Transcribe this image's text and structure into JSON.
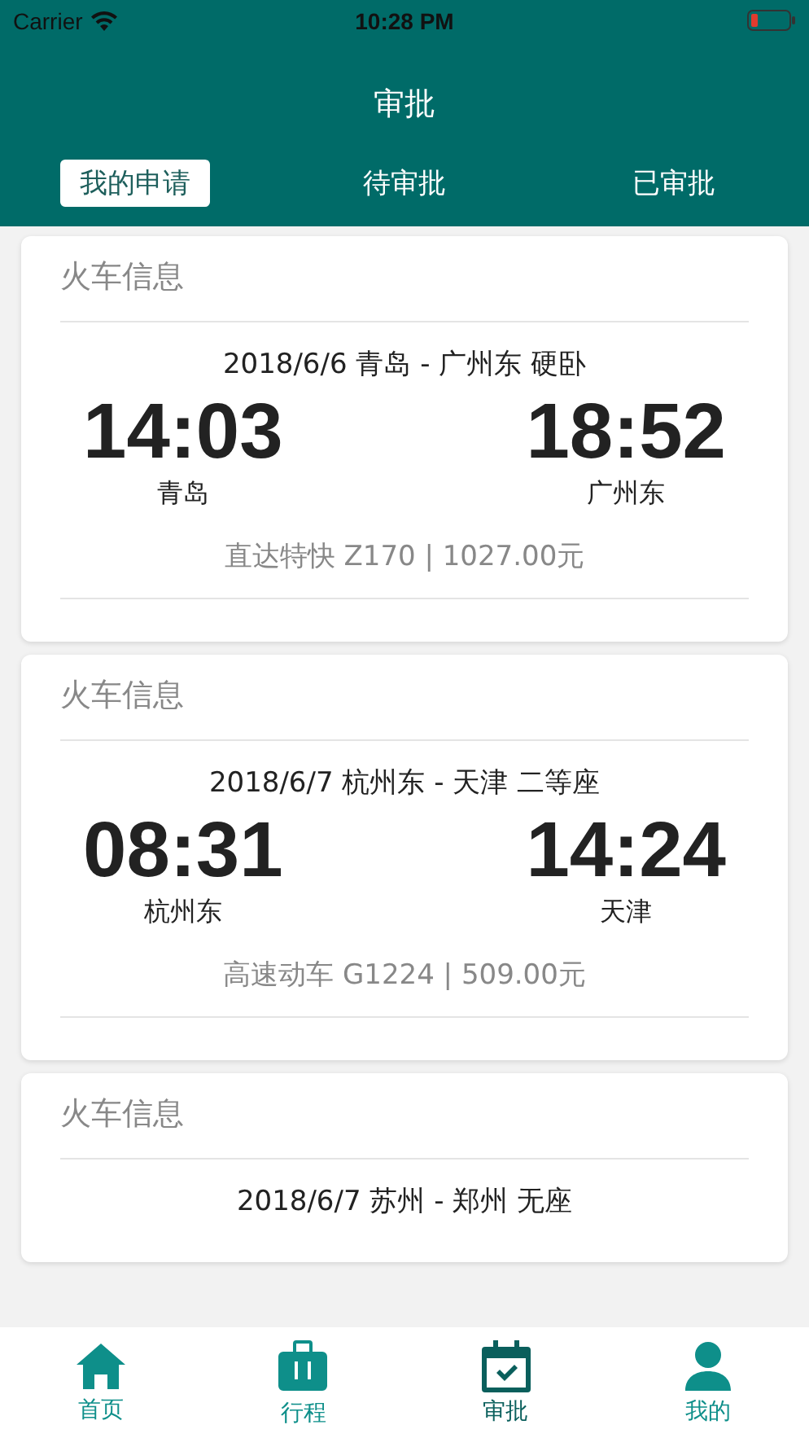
{
  "status_bar": {
    "carrier": "Carrier",
    "time": "10:28 PM"
  },
  "title": "审批",
  "tabs": [
    {
      "label": "我的申请",
      "selected": true
    },
    {
      "label": "待审批",
      "selected": false
    },
    {
      "label": "已审批",
      "selected": false
    }
  ],
  "cards": [
    {
      "heading": "火车信息",
      "route": "2018/6/6  青岛 - 广州东  硬卧",
      "depart_time": "14:03",
      "arrive_time": "18:52",
      "depart_station": "青岛",
      "arrive_station": "广州东",
      "train": "直达特快 Z170 | 1027.00元"
    },
    {
      "heading": "火车信息",
      "route": "2018/6/7  杭州东 - 天津  二等座",
      "depart_time": "08:31",
      "arrive_time": "14:24",
      "depart_station": "杭州东",
      "arrive_station": "天津",
      "train": "高速动车 G1224 | 509.00元"
    },
    {
      "heading": "火车信息",
      "route": "2018/6/7  苏州 - 郑州  无座"
    }
  ],
  "bottom_nav": [
    {
      "kind": "home",
      "label": "首页",
      "selected": false
    },
    {
      "kind": "luggage",
      "label": "行程",
      "selected": false
    },
    {
      "kind": "calendar",
      "label": "审批",
      "selected": true
    },
    {
      "kind": "person",
      "label": "我的",
      "selected": false
    }
  ]
}
